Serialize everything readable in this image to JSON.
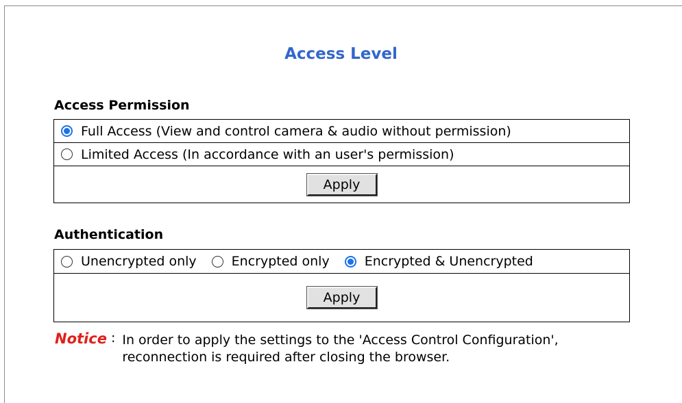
{
  "page": {
    "title": "Access Level"
  },
  "access_permission": {
    "heading": "Access Permission",
    "options": [
      {
        "label": "Full Access (View and control camera & audio without permission)",
        "checked": true
      },
      {
        "label": "Limited Access (In accordance with an user's permission)",
        "checked": false
      }
    ],
    "apply_label": "Apply"
  },
  "authentication": {
    "heading": "Authentication",
    "options": [
      {
        "label": "Unencrypted only",
        "checked": false
      },
      {
        "label": "Encrypted only",
        "checked": false
      },
      {
        "label": "Encrypted & Unencrypted",
        "checked": true
      }
    ],
    "apply_label": "Apply"
  },
  "notice": {
    "label": "Notice",
    "colon": ":",
    "line1": "In order to apply the settings to the 'Access Control Configuration',",
    "line2": "reconnection is required after closing the browser."
  },
  "colors": {
    "title": "#3366cc",
    "notice": "#e0201a",
    "radio_checked": "#1a73e8"
  }
}
